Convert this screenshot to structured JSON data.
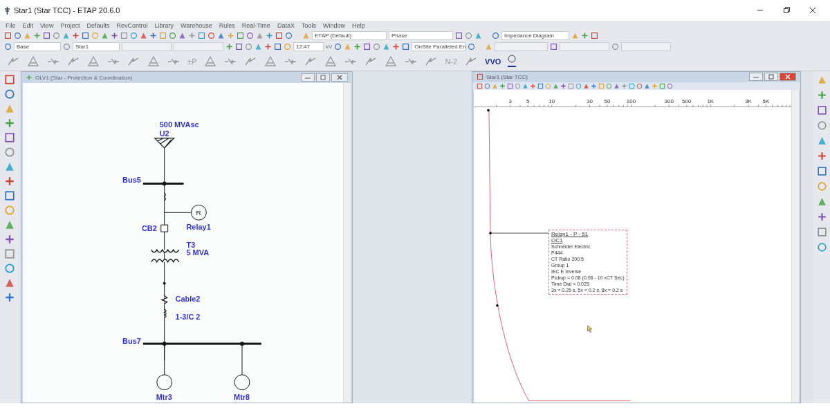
{
  "window": {
    "title": "Star1 (Star TCC) - ETAP 20.6.0"
  },
  "menu": [
    "File",
    "Edit",
    "View",
    "Project",
    "Defaults",
    "RevControl",
    "Library",
    "Warehouse",
    "Rules",
    "Real-Time",
    "DataX",
    "Tools",
    "Window",
    "Help"
  ],
  "toolbar": {
    "theme_field": "ETAP (Default)",
    "phase_field": "Phase",
    "view_field": "Impedance Diagram",
    "base_field": "Base",
    "star_field": "Star1",
    "time_field": "12:47",
    "unit": "kV",
    "mode_field": "OnSite Paralleled En",
    "tool_labels": [
      "±P",
      "N-2",
      "VVO"
    ]
  },
  "one_line_window": {
    "title": "OLV1 (Star - Protection & Coordination)",
    "diagram": {
      "source_rating": "500 MVAsc",
      "source": "U2",
      "bus_top": "Bus5",
      "relay_symbol": "R",
      "breaker": "CB2",
      "relay": "Relay1",
      "transformer": "T3",
      "transformer_rating": "5 MVA",
      "cable": "Cable2",
      "cable_size": "1-3/C 2",
      "bus_bottom": "Bus7",
      "motors": [
        {
          "name": "Mtr3"
        },
        {
          "name": "Mtr8"
        }
      ]
    }
  },
  "tcc_window": {
    "title": "Star1 (Star TCC)",
    "x_ticks": [
      "3",
      "5",
      "10",
      "30",
      "50",
      "100",
      "300",
      "500",
      "1K",
      "3K",
      "5K"
    ],
    "info_box": {
      "lines": [
        {
          "text": "Relay1 - P - 51",
          "kind": "heading"
        },
        {
          "text": "OC1",
          "kind": "heading"
        },
        {
          "text": "Schneider Electric",
          "kind": "plain"
        },
        {
          "text": "P444",
          "kind": "plain"
        },
        {
          "text": "CT Ratio 200:5",
          "kind": "plain"
        },
        {
          "text": "Group 1",
          "kind": "plain"
        },
        {
          "text": "IEC E Inverse",
          "kind": "plain"
        },
        {
          "text": "Pickup = 0.08 (0.08 - 10  xCT Sec)",
          "kind": "plain"
        },
        {
          "text": "Time Dial = 0.025",
          "kind": "plain"
        },
        {
          "text": "3x = 0.25 s, 5x = 0.2 s, 8x = 0.2 s",
          "kind": "plain"
        }
      ]
    }
  }
}
